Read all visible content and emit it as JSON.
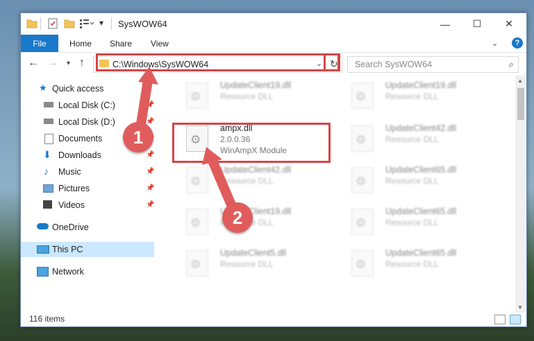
{
  "window": {
    "title": "SysWOW64",
    "controls": {
      "minimize": "—",
      "maximize": "☐",
      "close": "✕"
    }
  },
  "ribbon": {
    "tabs": [
      "File",
      "Home",
      "Share",
      "View"
    ],
    "help": "?"
  },
  "address": {
    "path": "C:\\Windows\\SysWOW64",
    "search_placeholder": "Search SysWOW64"
  },
  "sidebar": {
    "items": [
      {
        "label": "Quick access",
        "icon": "star-icon",
        "pinned": false
      },
      {
        "label": "Local Disk (C:)",
        "icon": "drive-icon",
        "pinned": true
      },
      {
        "label": "Local Disk (D:)",
        "icon": "drive-icon",
        "pinned": true
      },
      {
        "label": "Documents",
        "icon": "documents-icon",
        "pinned": true
      },
      {
        "label": "Downloads",
        "icon": "download-icon",
        "pinned": true
      },
      {
        "label": "Music",
        "icon": "music-icon",
        "pinned": true
      },
      {
        "label": "Pictures",
        "icon": "pictures-icon",
        "pinned": true
      },
      {
        "label": "Videos",
        "icon": "videos-icon",
        "pinned": true
      },
      {
        "label": "OneDrive",
        "icon": "cloud-icon",
        "pinned": false
      },
      {
        "label": "This PC",
        "icon": "computer-icon",
        "pinned": false,
        "selected": true
      },
      {
        "label": "Network",
        "icon": "network-icon",
        "pinned": false
      }
    ]
  },
  "files": {
    "highlighted": {
      "name": "ampx.dll",
      "version": "2.0.0.36",
      "description": "WinAmpX Module"
    },
    "left_column": [
      {
        "name": "UpdateClient19.dll",
        "description": "Resource DLL"
      },
      {
        "name": "UpdateClient42.dll",
        "description": "Resource DLL"
      },
      {
        "name": "UpdateClient19.dll",
        "description": "Resource DLL"
      },
      {
        "name": "UpdateClient5.dll",
        "description": "Resource DLL"
      }
    ],
    "right_column": [
      {
        "name": "UpdateClient19.dll",
        "description": "Resource DLL"
      },
      {
        "name": "UpdateClient42.dll",
        "description": "Resource DLL"
      },
      {
        "name": "UpdateClient65.dll",
        "description": "Resource DLL"
      },
      {
        "name": "UpdateClient65.dll",
        "description": "Resource DLL"
      },
      {
        "name": "UpdateClient65.dll",
        "description": "Resource DLL"
      }
    ]
  },
  "status": {
    "item_count": "116 items"
  },
  "annotations": {
    "step1": "1",
    "step2": "2"
  },
  "colors": {
    "accent": "#1979ca",
    "highlight": "#d64545",
    "selected": "#cce8ff",
    "badge": "#e05c5c"
  }
}
